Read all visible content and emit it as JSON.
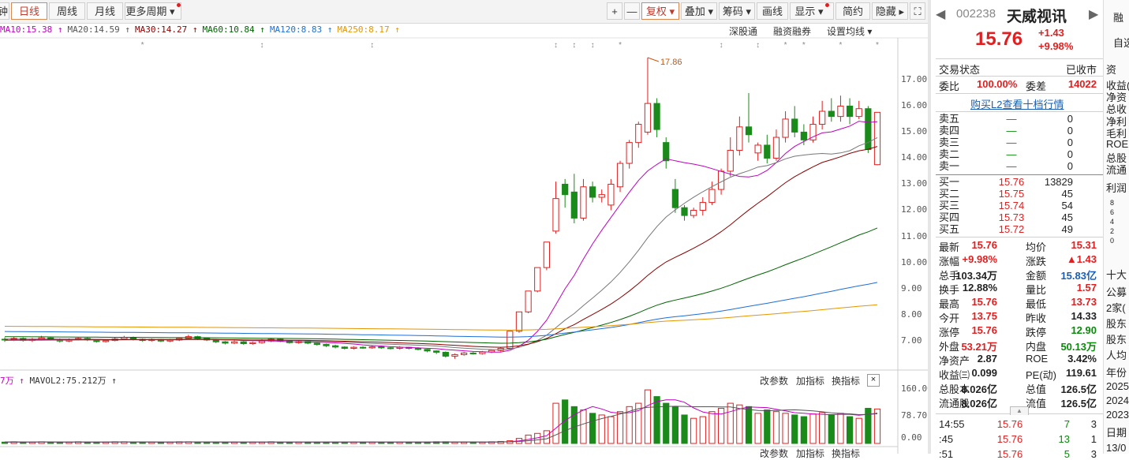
{
  "toolbar": {
    "partial_left": "钟",
    "tabs": [
      "日线",
      "周线",
      "月线",
      "更多周期"
    ],
    "active_tab": "日线",
    "right_buttons": [
      "+",
      "—",
      "复权",
      "叠加",
      "筹码",
      "画线",
      "显示",
      "简约",
      "隐藏"
    ]
  },
  "ma_legend": [
    {
      "label": "MA10:15.38",
      "color": "#c000c0"
    },
    {
      "label": "MA20:14.59",
      "color": "#555555"
    },
    {
      "label": "MA30:14.27",
      "color": "#8b0000"
    },
    {
      "label": "MA60:10.84",
      "color": "#006400"
    },
    {
      "label": "MA120:8.83",
      "color": "#1e6fd9"
    },
    {
      "label": "MA250:8.17",
      "color": "#e69500"
    }
  ],
  "chart_links": {
    "shen_gu_tong": "深股通",
    "rong_zi": "融资融券",
    "set_ma": "设置均线"
  },
  "price_axis": [
    "17.00",
    "16.00",
    "15.00",
    "14.00",
    "13.00",
    "12.00",
    "11.00",
    "10.00",
    "9.00",
    "8.00",
    "7.00"
  ],
  "high_annotation": "17.86",
  "vol_axis": [
    "160.00",
    "78.70",
    "0.00"
  ],
  "volume_legend": {
    "partial": "7万",
    "mavol2": "MAVOL2:75.212万"
  },
  "volume_links": [
    "改参数",
    "加指标",
    "换指标"
  ],
  "volume_close": "×",
  "bottom_links_partial": [
    "改参数",
    "加指标",
    "换指标"
  ],
  "chart_data": {
    "type": "candlestick",
    "ylim": [
      6.2,
      18.1
    ],
    "candles": [
      [
        7.05,
        7.02,
        7.12,
        6.95
      ],
      [
        7.02,
        7.08,
        7.15,
        6.98
      ],
      [
        7.08,
        7.0,
        7.12,
        6.96
      ],
      [
        7.0,
        7.05,
        7.1,
        6.95
      ],
      [
        7.05,
        7.1,
        7.18,
        7.0
      ],
      [
        7.1,
        7.04,
        7.14,
        7.0
      ],
      [
        7.04,
        6.98,
        7.08,
        6.92
      ],
      [
        6.98,
        7.03,
        7.08,
        6.94
      ],
      [
        7.03,
        7.08,
        7.12,
        7.0
      ],
      [
        7.08,
        7.02,
        7.12,
        6.98
      ],
      [
        7.02,
        6.96,
        7.05,
        6.92
      ],
      [
        6.96,
        7.0,
        7.05,
        6.92
      ],
      [
        7.0,
        7.06,
        7.12,
        6.97
      ],
      [
        7.06,
        7.12,
        7.18,
        7.02
      ],
      [
        7.12,
        7.05,
        7.15,
        7.0
      ],
      [
        7.05,
        7.0,
        7.08,
        6.96
      ],
      [
        7.0,
        7.04,
        7.08,
        6.96
      ],
      [
        7.04,
        6.98,
        7.06,
        6.94
      ],
      [
        6.98,
        7.02,
        7.06,
        6.94
      ],
      [
        7.02,
        7.08,
        7.12,
        6.98
      ],
      [
        7.08,
        7.15,
        7.22,
        7.05
      ],
      [
        7.15,
        7.08,
        7.18,
        7.02
      ],
      [
        7.08,
        7.02,
        7.1,
        6.98
      ],
      [
        7.02,
        6.95,
        7.05,
        6.9
      ],
      [
        6.95,
        6.9,
        6.98,
        6.85
      ],
      [
        6.9,
        6.95,
        7.0,
        6.86
      ],
      [
        6.95,
        6.88,
        6.98,
        6.84
      ],
      [
        6.88,
        6.92,
        6.96,
        6.84
      ],
      [
        6.92,
        6.98,
        7.05,
        6.88
      ],
      [
        6.98,
        7.05,
        7.1,
        6.94
      ],
      [
        7.05,
        6.98,
        7.08,
        6.94
      ],
      [
        6.98,
        6.92,
        7.0,
        6.88
      ],
      [
        6.92,
        6.96,
        7.0,
        6.88
      ],
      [
        6.96,
        6.9,
        6.98,
        6.86
      ],
      [
        6.9,
        6.85,
        6.92,
        6.8
      ],
      [
        6.85,
        6.8,
        6.88,
        6.75
      ],
      [
        6.8,
        6.75,
        6.84,
        6.7
      ],
      [
        6.75,
        6.7,
        6.78,
        6.66
      ],
      [
        6.7,
        6.74,
        6.78,
        6.66
      ],
      [
        6.74,
        6.72,
        6.78,
        6.68
      ],
      [
        6.72,
        6.76,
        6.8,
        6.68
      ],
      [
        6.76,
        6.72,
        6.8,
        6.68
      ],
      [
        6.72,
        6.7,
        6.76,
        6.66
      ],
      [
        6.7,
        6.74,
        6.78,
        6.66
      ],
      [
        6.74,
        6.7,
        6.76,
        6.66
      ],
      [
        6.7,
        6.66,
        6.74,
        6.62
      ],
      [
        6.66,
        6.6,
        6.68,
        6.55
      ],
      [
        6.6,
        6.55,
        6.62,
        6.48
      ],
      [
        6.55,
        6.4,
        6.58,
        6.35
      ],
      [
        6.4,
        6.46,
        6.5,
        6.3
      ],
      [
        6.46,
        6.52,
        6.56,
        6.42
      ],
      [
        6.52,
        6.5,
        6.56,
        6.46
      ],
      [
        6.5,
        6.56,
        6.6,
        6.46
      ],
      [
        6.56,
        6.62,
        6.66,
        6.52
      ],
      [
        6.62,
        6.7,
        6.75,
        6.58
      ],
      [
        6.7,
        7.36,
        7.36,
        6.66
      ],
      [
        7.36,
        8.1,
        8.1,
        7.3
      ],
      [
        8.1,
        8.9,
        8.9,
        8.05
      ],
      [
        8.9,
        9.8,
        9.8,
        8.85
      ],
      [
        9.8,
        10.78,
        10.78,
        9.7
      ],
      [
        11.2,
        12.45,
        13.1,
        11.1
      ],
      [
        13.0,
        12.6,
        13.2,
        12.1
      ],
      [
        12.7,
        11.7,
        13.4,
        11.5
      ],
      [
        11.7,
        12.9,
        13.2,
        11.6
      ],
      [
        12.9,
        12.5,
        13.1,
        12.3
      ],
      [
        12.5,
        12.6,
        12.8,
        12.3
      ],
      [
        12.2,
        13.0,
        13.2,
        12.0
      ],
      [
        12.9,
        13.8,
        13.9,
        12.7
      ],
      [
        13.8,
        14.6,
        14.7,
        13.6
      ],
      [
        14.6,
        15.3,
        15.4,
        14.4
      ],
      [
        15.0,
        16.1,
        17.86,
        14.9
      ],
      [
        16.1,
        15.1,
        16.3,
        14.8
      ],
      [
        14.6,
        13.9,
        14.8,
        13.6
      ],
      [
        12.8,
        12.1,
        13.2,
        11.9
      ],
      [
        12.1,
        11.8,
        12.2,
        11.6
      ],
      [
        11.8,
        12.0,
        12.1,
        11.7
      ],
      [
        12.0,
        12.3,
        12.5,
        11.8
      ],
      [
        12.3,
        12.8,
        13.1,
        12.2
      ],
      [
        12.8,
        13.5,
        13.6,
        12.6
      ],
      [
        13.5,
        14.3,
        14.8,
        13.3
      ],
      [
        14.3,
        15.2,
        15.6,
        14.1
      ],
      [
        15.2,
        14.9,
        16.5,
        14.6
      ],
      [
        14.2,
        14.5,
        14.6,
        13.9
      ],
      [
        14.5,
        14.0,
        14.9,
        13.8
      ],
      [
        14.0,
        14.8,
        15.1,
        13.9
      ],
      [
        14.8,
        15.5,
        15.8,
        14.6
      ],
      [
        15.5,
        15.0,
        16.0,
        14.8
      ],
      [
        15.0,
        14.7,
        15.3,
        14.5
      ],
      [
        14.7,
        15.3,
        15.6,
        14.6
      ],
      [
        15.3,
        15.8,
        16.2,
        15.1
      ],
      [
        15.8,
        15.6,
        16.3,
        15.4
      ],
      [
        15.6,
        16.0,
        16.4,
        15.4
      ],
      [
        16.0,
        15.6,
        16.3,
        15.3
      ],
      [
        15.6,
        15.9,
        16.2,
        15.5
      ],
      [
        15.9,
        14.33,
        16.0,
        14.2
      ],
      [
        13.75,
        15.76,
        15.76,
        13.73
      ]
    ],
    "volume_ylim": [
      0,
      165
    ],
    "volumes": [
      4,
      5,
      4,
      4,
      5,
      4,
      4,
      4,
      5,
      4,
      4,
      4,
      5,
      5,
      4,
      4,
      4,
      4,
      4,
      5,
      5,
      4,
      4,
      4,
      4,
      4,
      4,
      4,
      4,
      5,
      4,
      4,
      4,
      4,
      4,
      4,
      4,
      4,
      4,
      4,
      4,
      4,
      4,
      4,
      4,
      4,
      4,
      5,
      5,
      4,
      4,
      4,
      4,
      5,
      6,
      8,
      15,
      25,
      30,
      38,
      120,
      130,
      110,
      100,
      90,
      85,
      80,
      95,
      110,
      120,
      160,
      140,
      120,
      110,
      85,
      75,
      80,
      95,
      105,
      120,
      115,
      110,
      90,
      100,
      95,
      90,
      85,
      80,
      88,
      92,
      85,
      90,
      80,
      75,
      105,
      103
    ]
  },
  "stock": {
    "code": "002238",
    "name": "天威视讯",
    "price": "15.76",
    "change": "+1.43",
    "change_pct": "+9.98%",
    "side_buttons": [
      "融",
      "自选"
    ],
    "trade_status_label": "交易状态",
    "trade_status": "已收市",
    "weibi_label": "委比",
    "weibi": "100.00%",
    "weicha_label": "委差",
    "weicha": "14022",
    "l2_link": "购买L2查看十档行情"
  },
  "order_book": {
    "sells": [
      {
        "name": "卖五",
        "price": "—",
        "qty": "0"
      },
      {
        "name": "卖四",
        "price": "—",
        "qty": "0"
      },
      {
        "name": "卖三",
        "price": "—",
        "qty": "0"
      },
      {
        "name": "卖二",
        "price": "—",
        "qty": "0"
      },
      {
        "name": "卖一",
        "price": "—",
        "qty": "0"
      }
    ],
    "buys": [
      {
        "name": "买一",
        "price": "15.76",
        "qty": "13829"
      },
      {
        "name": "买二",
        "price": "15.75",
        "qty": "45"
      },
      {
        "name": "买三",
        "price": "15.74",
        "qty": "54"
      },
      {
        "name": "买四",
        "price": "15.73",
        "qty": "45"
      },
      {
        "name": "买五",
        "price": "15.72",
        "qty": "49"
      }
    ]
  },
  "quote": [
    {
      "l1": "最新",
      "v1": "15.76",
      "c1": "red",
      "l2": "均价",
      "v2": "15.31",
      "c2": "red"
    },
    {
      "l1": "涨幅",
      "v1": "+9.98%",
      "c1": "red",
      "l2": "涨跌",
      "v2": "▲1.43",
      "c2": "red"
    },
    {
      "l1": "总手",
      "v1": "103.34万",
      "c1": "",
      "l2": "金额",
      "v2": "15.83亿",
      "c2": "blue"
    },
    {
      "l1": "换手",
      "v1": "12.88%",
      "c1": "",
      "l2": "量比",
      "v2": "1.57",
      "c2": "red"
    },
    {
      "l1": "最高",
      "v1": "15.76",
      "c1": "red",
      "l2": "最低",
      "v2": "13.73",
      "c2": "red"
    },
    {
      "l1": "今开",
      "v1": "13.75",
      "c1": "red",
      "l2": "昨收",
      "v2": "14.33",
      "c2": ""
    },
    {
      "l1": "涨停",
      "v1": "15.76",
      "c1": "red",
      "l2": "跌停",
      "v2": "12.90",
      "c2": "green"
    },
    {
      "l1": "外盘",
      "v1": "53.21万",
      "c1": "red",
      "l2": "内盘",
      "v2": "50.13万",
      "c2": "green"
    },
    {
      "l1": "净资产",
      "v1": "2.87",
      "c1": "",
      "l2": "ROE",
      "v2": "3.42%",
      "c2": ""
    },
    {
      "l1": "收益㈢",
      "v1": "0.099",
      "c1": "",
      "l2": "PE(动)",
      "v2": "119.61",
      "c2": ""
    },
    {
      "l1": "总股本",
      "v1": "8.026亿",
      "c1": "",
      "l2": "总值",
      "v2": "126.5亿",
      "c2": ""
    },
    {
      "l1": "流通股",
      "v1": "8.026亿",
      "c1": "",
      "l2": "流值",
      "v2": "126.5亿",
      "c2": ""
    }
  ],
  "ticks": [
    {
      "t": "14:55",
      "p": "15.76",
      "v": "7",
      "n": "3"
    },
    {
      "t": ":45",
      "p": "15.76",
      "v": "13",
      "n": "1"
    },
    {
      "t": ":51",
      "p": "15.76",
      "v": "5",
      "n": "3"
    }
  ],
  "far_right": [
    "资",
    "收益(",
    "净资",
    "总收",
    "净利",
    "毛利",
    "ROE",
    "总股",
    "流通",
    "利润",
    "8",
    "6",
    "4",
    "2",
    "0",
    "十大",
    "公募",
    "2家(",
    "股东",
    "股东",
    "人均",
    "年份",
    "2025",
    "2024",
    "2023",
    "日期",
    "13/0"
  ]
}
